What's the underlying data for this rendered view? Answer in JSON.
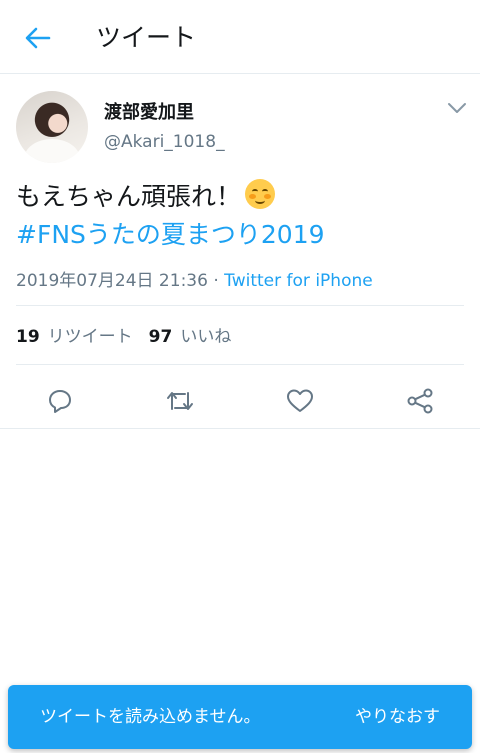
{
  "header": {
    "title": "ツイート",
    "back_icon": "arrow-left-icon"
  },
  "tweet": {
    "author": {
      "display_name": "渡部愛加里",
      "handle": "@Akari_1018_"
    },
    "text": "もえちゃん頑張れ！",
    "emoji": "smiling-face-with-blush",
    "hashtag": "#FNSうたの夏まつり2019",
    "timestamp": "2019年07月24日 21:36",
    "separator": "·",
    "source": "Twitter for iPhone",
    "stats": {
      "retweets": "19",
      "retweets_label": "リツイート",
      "likes": "97",
      "likes_label": "いいね"
    },
    "actions": [
      "reply-icon",
      "retweet-icon",
      "like-icon",
      "share-icon"
    ]
  },
  "toast": {
    "message": "ツイートを読み込めません。",
    "retry_label": "やりなおす"
  },
  "colors": {
    "accent": "#1da1f2",
    "secondary_text": "#657786",
    "divider": "#e6ecf0"
  }
}
